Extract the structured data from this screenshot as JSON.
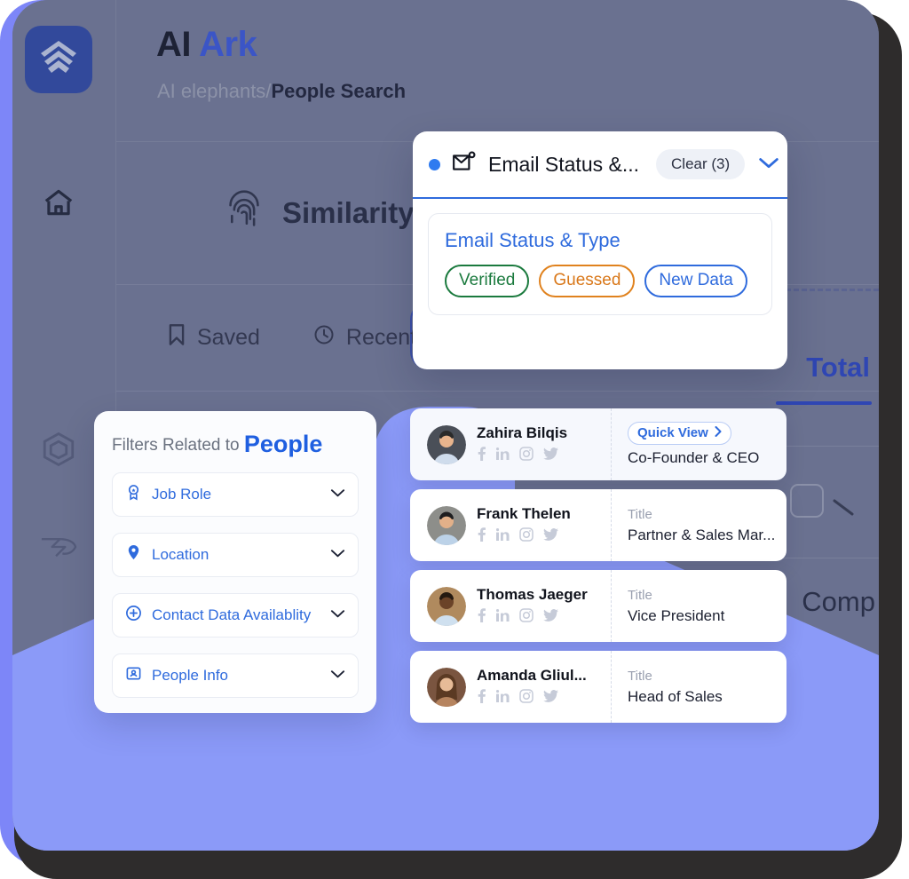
{
  "app": {
    "brand_first": "AI",
    "brand_second": "Ark",
    "breadcrumb_parent": "AI elephants",
    "breadcrumb_sep": "/",
    "breadcrumb_current": "People Search",
    "accent_blue": "#2f6bdd",
    "brand_blue": "#3b55c6",
    "screen_bg": "#6a7190",
    "funnel_color": "#8b9af8",
    "device_frame": "#2e2c2c"
  },
  "sidebar": {
    "items": [
      {
        "name": "logo",
        "icon": "logo-icon",
        "active": true
      },
      {
        "name": "home",
        "icon": "home-icon",
        "active": false
      },
      {
        "name": "people",
        "icon": "people-search-icon",
        "active": true
      },
      {
        "name": "hexagon",
        "icon": "hexagon-icon",
        "active": false
      },
      {
        "name": "bird",
        "icon": "bird-icon",
        "active": false
      }
    ]
  },
  "similarity": {
    "icon": "fingerprint-icon",
    "title": "Similarity Search"
  },
  "tabs": [
    {
      "label": "Saved",
      "icon": "bookmark-icon"
    },
    {
      "label": "Recent",
      "icon": "clock-icon"
    }
  ],
  "background_right": {
    "total_label": "Total",
    "company_label": "Comp",
    "checkbox_icon": "checkbox-icon",
    "chevron_icon": "chevron-down-icon"
  },
  "popup": {
    "icon": "email-status-icon",
    "title": "Email Status &...",
    "clear_label": "Clear (3)",
    "chevron_icon": "chevron-down-icon",
    "section_title": "Email Status & Type",
    "chips": [
      {
        "label": "Verified",
        "color": "#1b7a3e",
        "style": "green"
      },
      {
        "label": "Guessed",
        "color": "#d9781a",
        "style": "orange"
      },
      {
        "label": "New Data",
        "color": "#2f6bdd",
        "style": "blue"
      }
    ]
  },
  "filters": {
    "heading_prefix": "Filters Related to",
    "heading_strong": "People",
    "rows": [
      {
        "label": "Job Role",
        "icon": "job-role-icon"
      },
      {
        "label": "Location",
        "icon": "location-pin-icon"
      },
      {
        "label": "Contact Data Availablity",
        "icon": "contact-data-icon"
      },
      {
        "label": "People Info",
        "icon": "people-info-icon"
      }
    ]
  },
  "people": {
    "title_label": "Title",
    "quick_view_label": "Quick View",
    "socials": [
      "facebook-icon",
      "linkedin-icon",
      "instagram-icon",
      "twitter-icon"
    ],
    "cards": [
      {
        "name": "Zahira Bilqis",
        "title": "Co-Founder & CEO",
        "has_quick_view": true,
        "avatar": "#4a4f58",
        "skin": "#e8b48d",
        "shirt": "#cfdcec",
        "hair": "#2a2a2a"
      },
      {
        "name": "Frank Thelen",
        "title": "Partner & Sales Mar...",
        "has_quick_view": false,
        "avatar": "#8d8e8a",
        "skin": "#e2b089",
        "shirt": "#bcd2e8",
        "hair": "#1e1e20"
      },
      {
        "name": "Thomas Jaeger",
        "title": "Vice President",
        "has_quick_view": false,
        "avatar": "#b08a5e",
        "skin": "#6b4328",
        "shirt": "#cfe0ef",
        "hair": "#241910"
      },
      {
        "name": "Amanda Gliul...",
        "title": "Head of Sales",
        "has_quick_view": false,
        "avatar": "#7a5540",
        "skin": "#e7bb97",
        "shirt": "#b6845f",
        "hair": "#5b3a23"
      }
    ]
  }
}
